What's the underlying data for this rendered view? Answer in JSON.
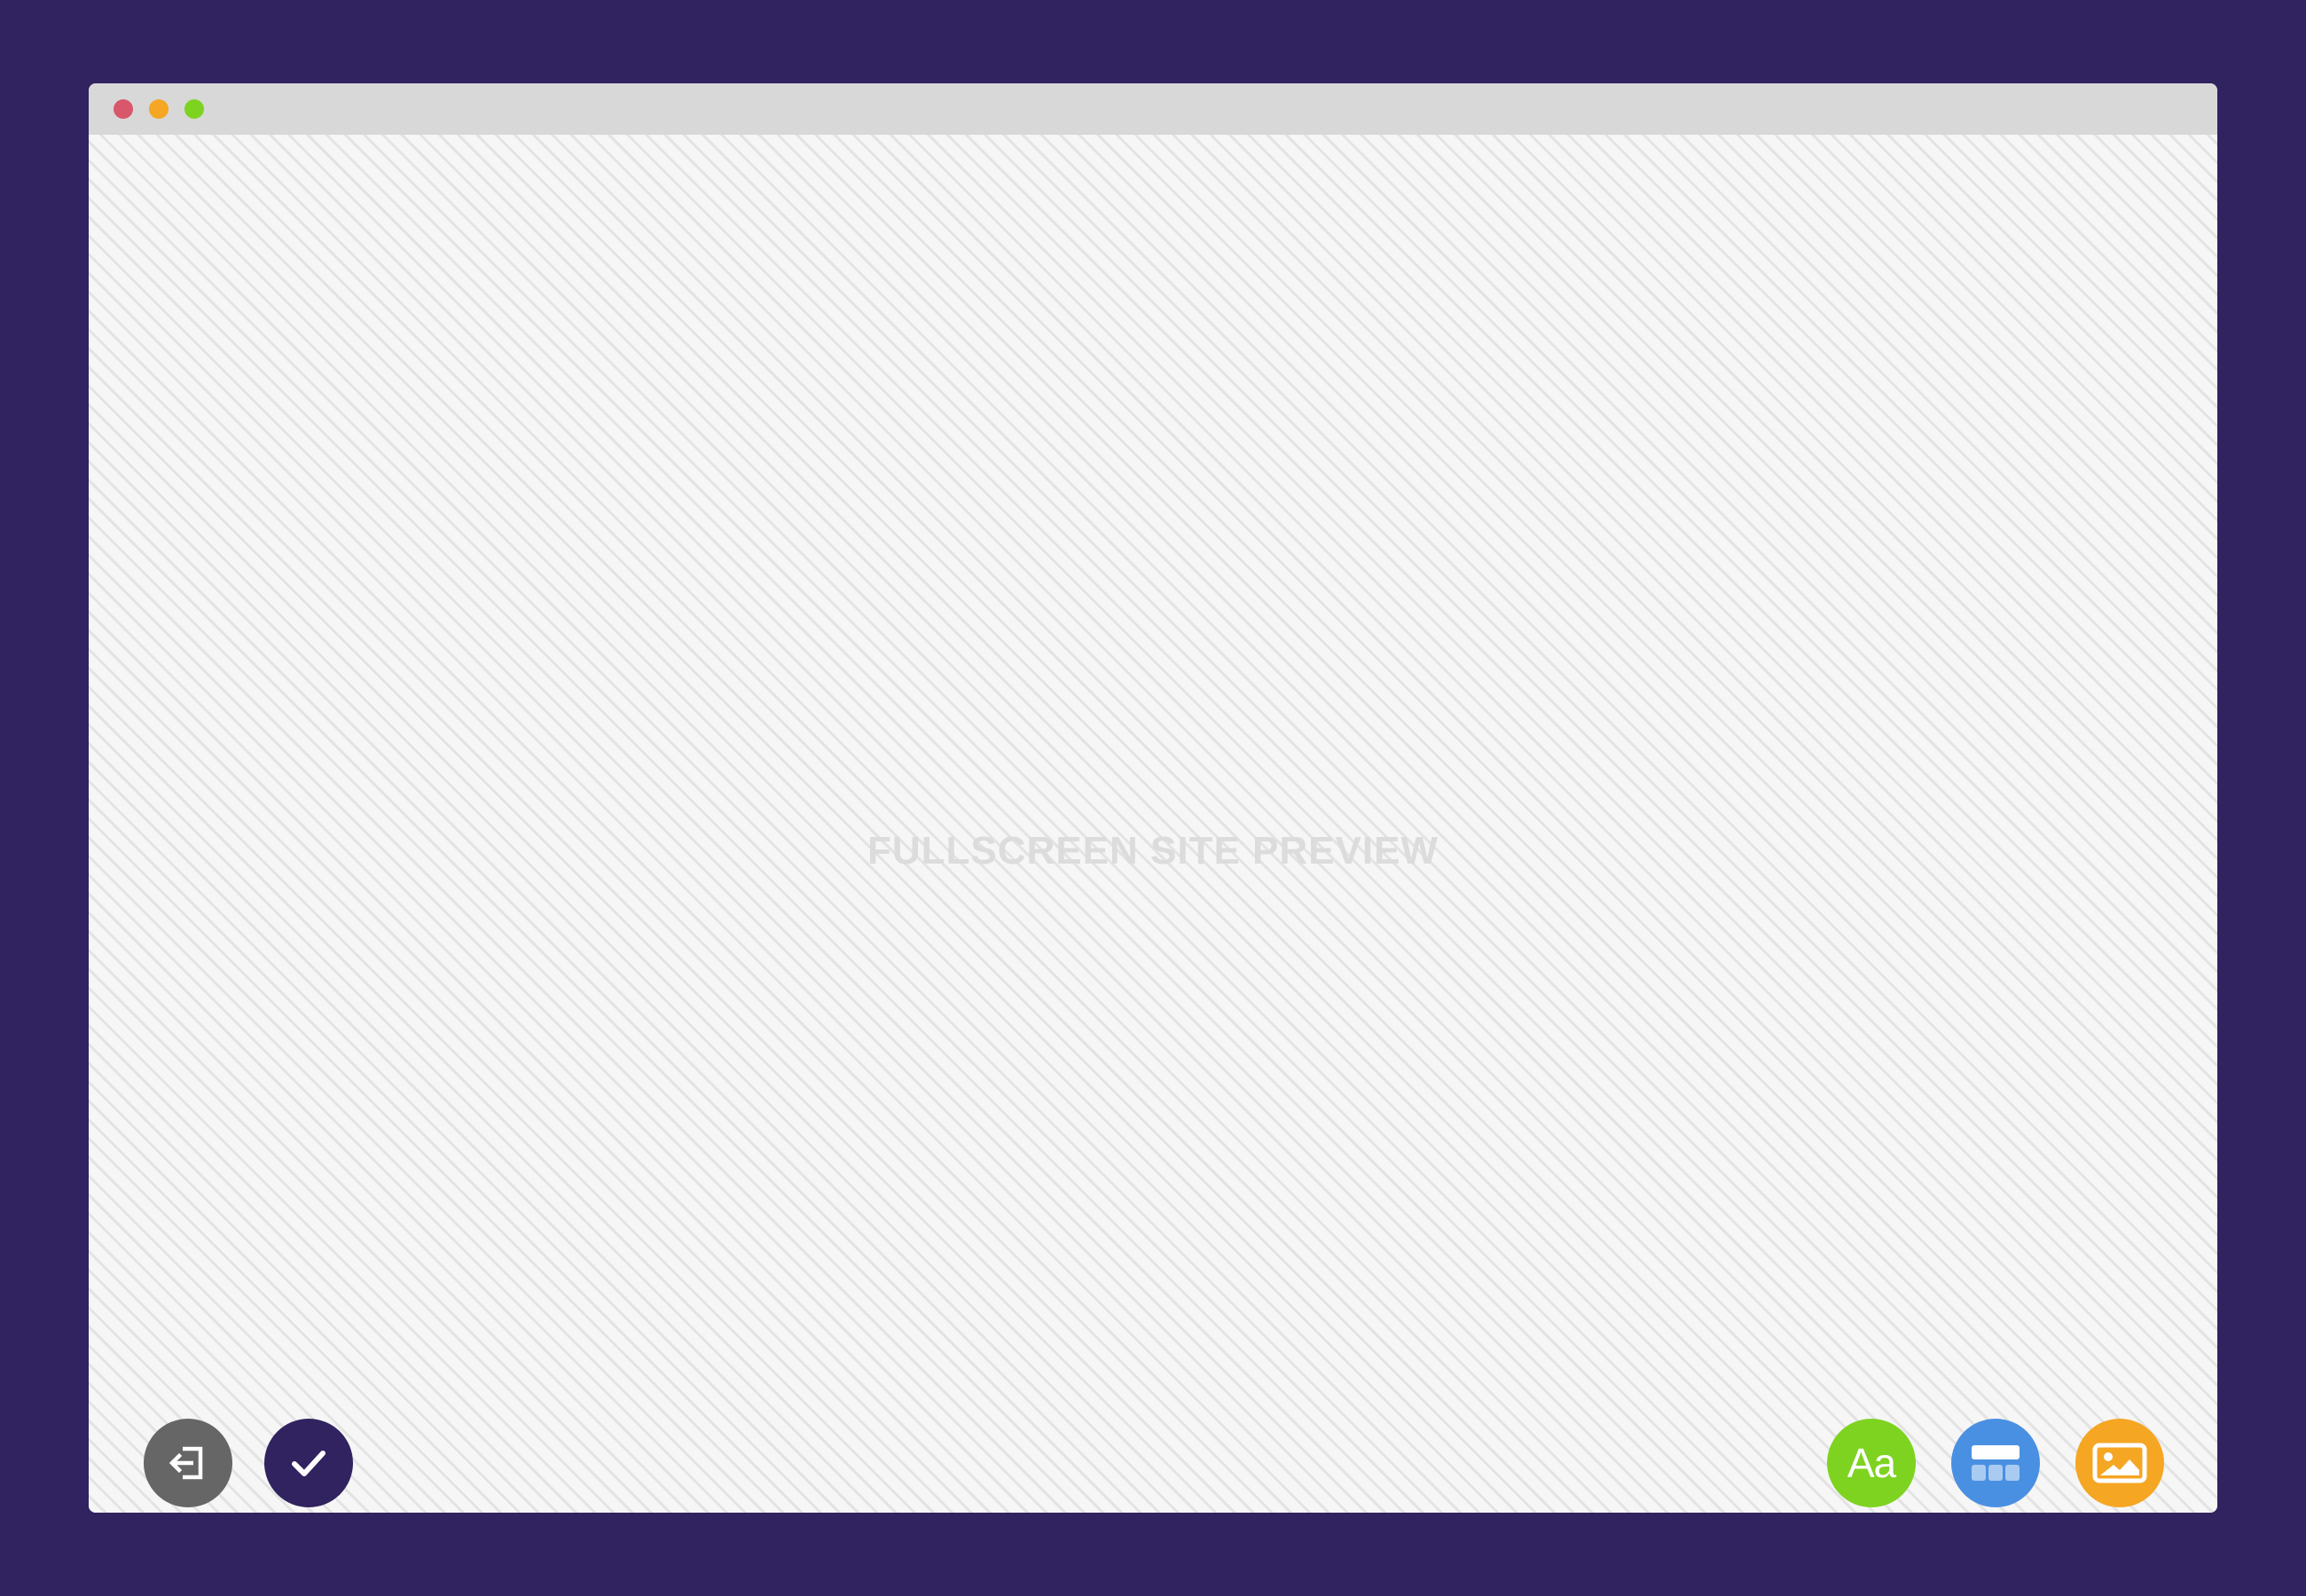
{
  "window": {
    "traffic_lights": {
      "close_color": "#d9576a",
      "minimize_color": "#f5a623",
      "zoom_color": "#7ed321"
    }
  },
  "preview": {
    "label": "FULLSCREEN SITE PREVIEW"
  },
  "left_actions": [
    {
      "name": "exit-preview",
      "icon": "sign-in-arrow-icon",
      "color": "#666666"
    },
    {
      "name": "confirm",
      "icon": "checkmark-icon",
      "color": "#302360"
    }
  ],
  "right_actions": [
    {
      "name": "typography",
      "icon": "font-icon",
      "label": "Aa",
      "color": "#7ed321"
    },
    {
      "name": "layout",
      "icon": "layout-icon",
      "color": "#4a90e2"
    },
    {
      "name": "image",
      "icon": "image-icon",
      "color": "#f5a623"
    }
  ]
}
